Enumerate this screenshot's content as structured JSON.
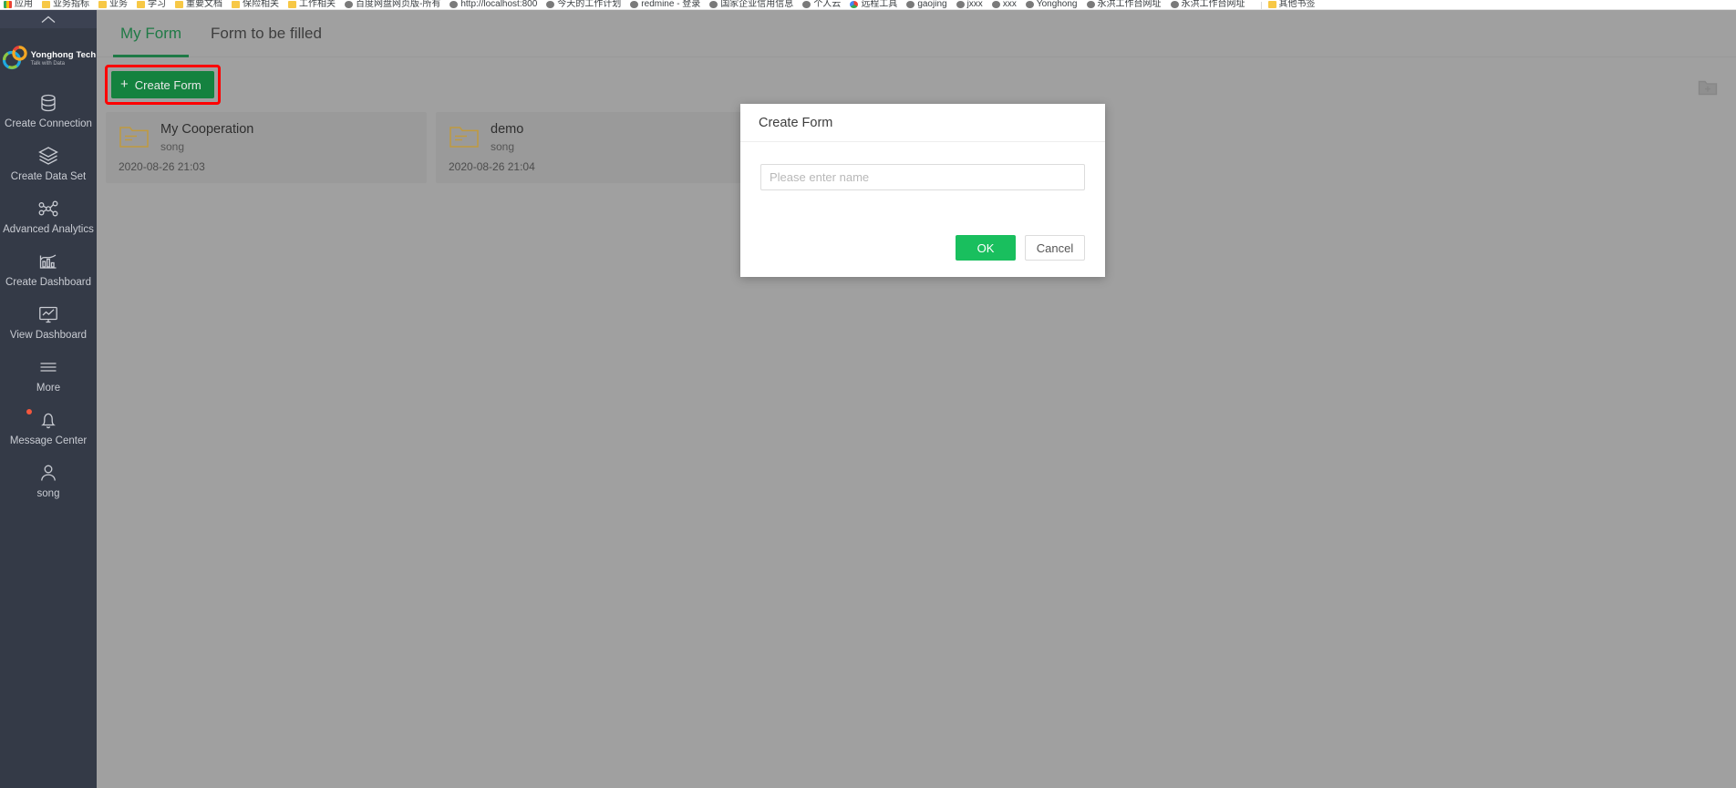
{
  "browser": {
    "bookmarks": [
      {
        "label": "应用",
        "icon": "multi-color-icon"
      },
      {
        "label": "业务指标",
        "icon": "folder-icon"
      },
      {
        "label": "业务",
        "icon": "folder-icon"
      },
      {
        "label": "学习",
        "icon": "folder-icon"
      },
      {
        "label": "重要文档",
        "icon": "folder-icon"
      },
      {
        "label": "保险相关",
        "icon": "folder-icon"
      },
      {
        "label": "工作相关",
        "icon": "folder-icon"
      },
      {
        "label": "百度网盘网页版-所有",
        "icon": "globe-icon"
      },
      {
        "label": "http://localhost:800",
        "icon": "globe-icon"
      },
      {
        "label": "今天的工作计划",
        "icon": "globe-icon"
      },
      {
        "label": "redmine - 登录",
        "icon": "globe-icon"
      },
      {
        "label": "国家企业信用信息",
        "icon": "globe-icon"
      },
      {
        "label": "个人云",
        "icon": "globe-icon"
      },
      {
        "label": "远程工具",
        "icon": "chrome-icon"
      },
      {
        "label": "gaojing",
        "icon": "globe-icon"
      },
      {
        "label": "jxxx",
        "icon": "globe-icon"
      },
      {
        "label": "xxx",
        "icon": "globe-icon"
      },
      {
        "label": "Yonghong",
        "icon": "globe-icon"
      },
      {
        "label": "永洪工作台网址",
        "icon": "globe-icon"
      },
      {
        "label": "永洪工作台网址",
        "icon": "globe-icon"
      },
      {
        "label": "其他书签",
        "icon": "folder-icon"
      }
    ]
  },
  "sidebar": {
    "collapse_icon": "chevron-up-icon",
    "brand": {
      "name": "Yonghong Tech",
      "tagline": "Talk with Data",
      "logo_icon": "yonghong-logo-icon"
    },
    "items": [
      {
        "label": "Create Connection",
        "icon": "database-icon",
        "badge": false
      },
      {
        "label": "Create Data Set",
        "icon": "layers-icon",
        "badge": false
      },
      {
        "label": "Advanced Analytics",
        "icon": "nodes-icon",
        "badge": false
      },
      {
        "label": "Create Dashboard",
        "icon": "bar-chart-icon",
        "badge": false
      },
      {
        "label": "View Dashboard",
        "icon": "monitor-icon",
        "badge": false
      },
      {
        "label": "More",
        "icon": "hamburger-icon",
        "badge": false
      },
      {
        "label": "Message Center",
        "icon": "bell-icon",
        "badge": true
      },
      {
        "label": "song",
        "icon": "user-icon",
        "badge": false
      }
    ]
  },
  "main": {
    "tabs": [
      {
        "label": "My Form",
        "active": true
      },
      {
        "label": "Form to be filled",
        "active": false
      }
    ],
    "toolbar": {
      "create_form_label": "Create Form",
      "plus_glyph": "+",
      "highlight_color": "#ff0000",
      "button_color": "#14823f"
    },
    "new_folder_icon": "new-folder-icon",
    "cards": [
      {
        "title": "My Cooperation",
        "owner": "song",
        "date": "2020-08-26 21:03",
        "icon": "folder-icon"
      },
      {
        "title": "demo",
        "owner": "song",
        "date": "2020-08-26 21:04",
        "icon": "folder-icon"
      }
    ]
  },
  "modal": {
    "title": "Create Form",
    "input": {
      "value": "",
      "placeholder": "Please enter name"
    },
    "ok_label": "OK",
    "cancel_label": "Cancel",
    "ok_color": "#19bf5e"
  }
}
